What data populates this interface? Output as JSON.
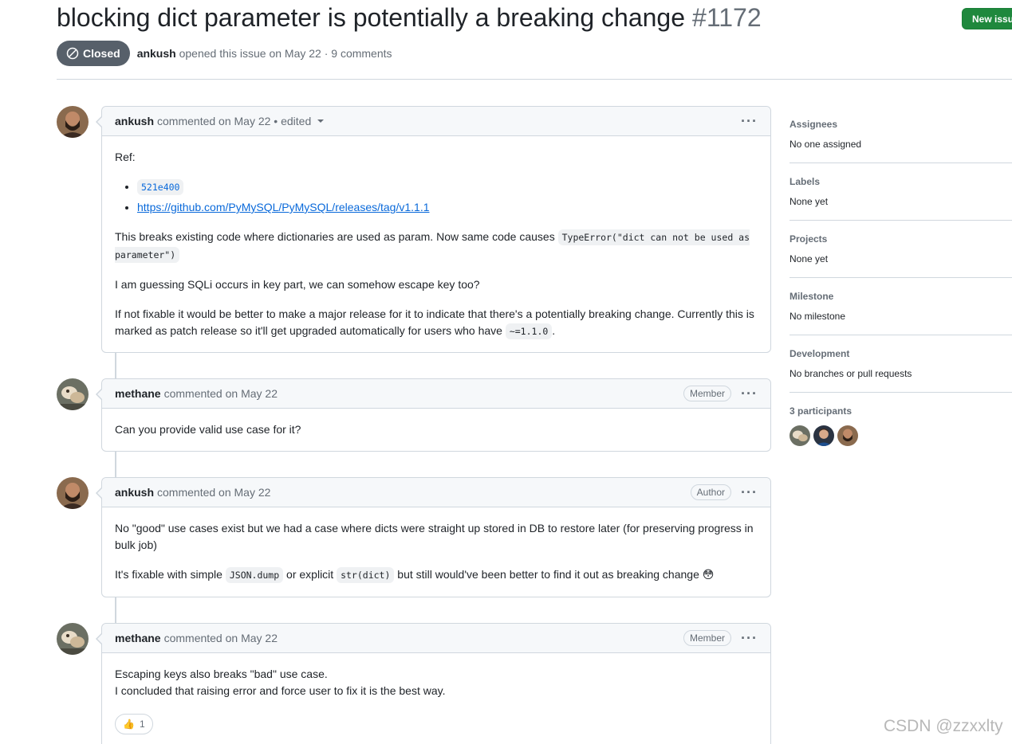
{
  "issue": {
    "title": "blocking dict parameter is potentially a breaking change",
    "number": "#1172",
    "status": "Closed",
    "author": "ankush",
    "opened_text": "opened this issue on May 22 · 9 comments",
    "new_issue_label": "New issue"
  },
  "comments": [
    {
      "author": "ankush",
      "meta": "commented on May 22 • edited",
      "body": {
        "ref": "Ref:",
        "sha": "521e400",
        "link": "https://github.com/PyMySQL/PyMySQL/releases/tag/v1.1.1",
        "p1_pre": "This breaks existing code where dictionaries are used as param. Now same code causes",
        "p1_code": "TypeError(\"dict can not be used as parameter\")",
        "p2": "I am guessing SQLi occurs in key part, we can somehow escape key too?",
        "p3_pre": "If not fixable it would be better to make a major release for it to indicate that there's a potentially breaking change. Currently this is marked as patch release so it'll get upgraded automatically for users who have",
        "p3_code": "~=1.1.0",
        "p3_post": "."
      }
    },
    {
      "author": "methane",
      "meta": "commented on May 22",
      "role": "Member",
      "body": {
        "p1": "Can you provide valid use case for it?"
      }
    },
    {
      "author": "ankush",
      "meta": "commented on May 22",
      "role": "Author",
      "body": {
        "p1": "No \"good\" use cases exist but we had a case where dicts were straight up stored in DB to restore later (for preserving progress in bulk job)",
        "p2_pre": "It's fixable with simple",
        "p2_code1": "JSON.dump",
        "p2_mid": "or explicit",
        "p2_code2": "str(dict)",
        "p2_post": "but still would've been better to find it out as breaking change",
        "p2_emoji": "😳"
      }
    },
    {
      "author": "methane",
      "meta": "commented on May 22",
      "role": "Member",
      "body": {
        "line1": "Escaping keys also breaks \"bad\" use case.",
        "line2": "I concluded that raising error and force user to fix it is the best way.",
        "reaction_emoji": "👍",
        "reaction_count": "1"
      }
    }
  ],
  "sidebar": {
    "assignees": {
      "title": "Assignees",
      "value": "No one assigned"
    },
    "labels": {
      "title": "Labels",
      "value": "None yet"
    },
    "projects": {
      "title": "Projects",
      "value": "None yet"
    },
    "milestone": {
      "title": "Milestone",
      "value": "No milestone"
    },
    "development": {
      "title": "Development",
      "value": "No branches or pull requests"
    },
    "participants": {
      "title": "3 participants"
    }
  },
  "watermark": "CSDN @zzxxlty",
  "icons": {
    "closed": "circle-slash-icon",
    "kebab": "kebab-horizontal-icon",
    "caret": "triangle-down-icon"
  }
}
